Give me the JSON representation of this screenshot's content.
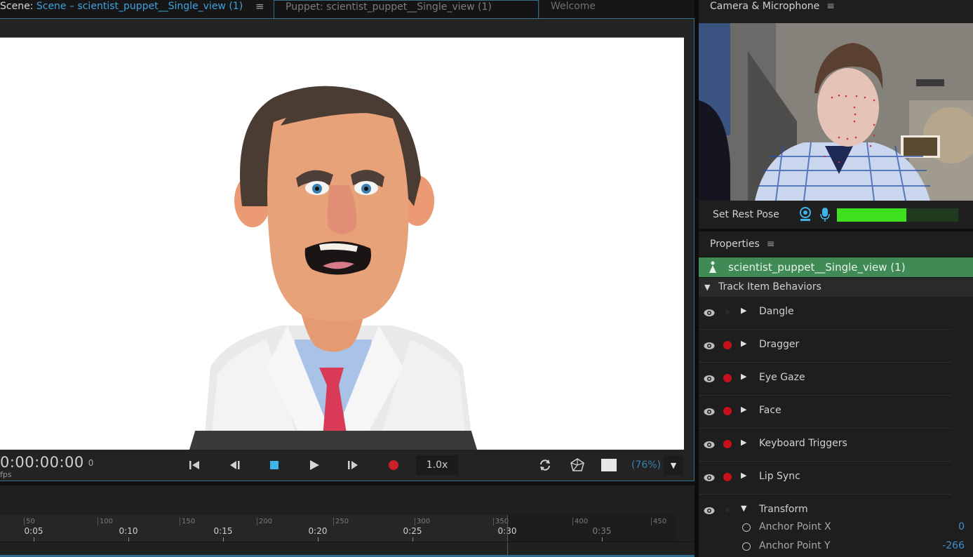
{
  "tabs": {
    "scene": {
      "prefix": "Scene:",
      "name": "Scene – scientist_puppet__Single_view (1)",
      "menu": "≡"
    },
    "puppet": {
      "label": "Puppet: scientist_puppet__Single_view (1)"
    },
    "welcome": {
      "label": "Welcome"
    }
  },
  "scene_panel": {
    "timecode": "0:00:00:00",
    "frame": "0",
    "fps_label": "fps",
    "transport": {
      "go_to_start": "⏮",
      "step_back": "◀︎|",
      "stop": "■",
      "play": "▶",
      "step_forward": "|▶",
      "record": "●"
    },
    "speed": "1.0x",
    "zoom_percent": "(76%)",
    "zoom_dropdown": "▼"
  },
  "timeline": {
    "frame_ticks": [
      "50",
      "100",
      "150",
      "200",
      "250",
      "300",
      "350",
      "400",
      "450"
    ],
    "time_ticks": [
      {
        "label": "0:05",
        "dim": false
      },
      {
        "label": "0:10",
        "dim": false
      },
      {
        "label": "0:15",
        "dim": false
      },
      {
        "label": "0:20",
        "dim": false
      },
      {
        "label": "0:25",
        "dim": false
      },
      {
        "label": "0:30",
        "dim": false
      },
      {
        "label": "0:35",
        "dim": true
      }
    ]
  },
  "camera": {
    "title": "Camera & Microphone",
    "menu": "≡",
    "rest_pose_label": "Set Rest Pose",
    "audio_level_percent": 57,
    "level_color": "#3ee01f"
  },
  "properties": {
    "title": "Properties",
    "menu": "≡",
    "puppet_name": "scientist_puppet__Single_view (1)",
    "section": "Track Item Behaviors",
    "behaviors": [
      {
        "name": "Dangle",
        "armed": false,
        "expanded": false
      },
      {
        "name": "Dragger",
        "armed": true,
        "expanded": false
      },
      {
        "name": "Eye Gaze",
        "armed": true,
        "expanded": false
      },
      {
        "name": "Face",
        "armed": true,
        "expanded": false
      },
      {
        "name": "Keyboard Triggers",
        "armed": true,
        "expanded": false
      },
      {
        "name": "Lip Sync",
        "armed": true,
        "expanded": false
      },
      {
        "name": "Transform",
        "armed": false,
        "expanded": true
      }
    ],
    "transform_props": [
      {
        "name": "Anchor Point X",
        "value": "0"
      },
      {
        "name": "Anchor Point Y",
        "value": "-266"
      }
    ],
    "accent_green": "#3f8a55",
    "record_red": "#c8101a",
    "value_blue": "#3e8fd0"
  }
}
